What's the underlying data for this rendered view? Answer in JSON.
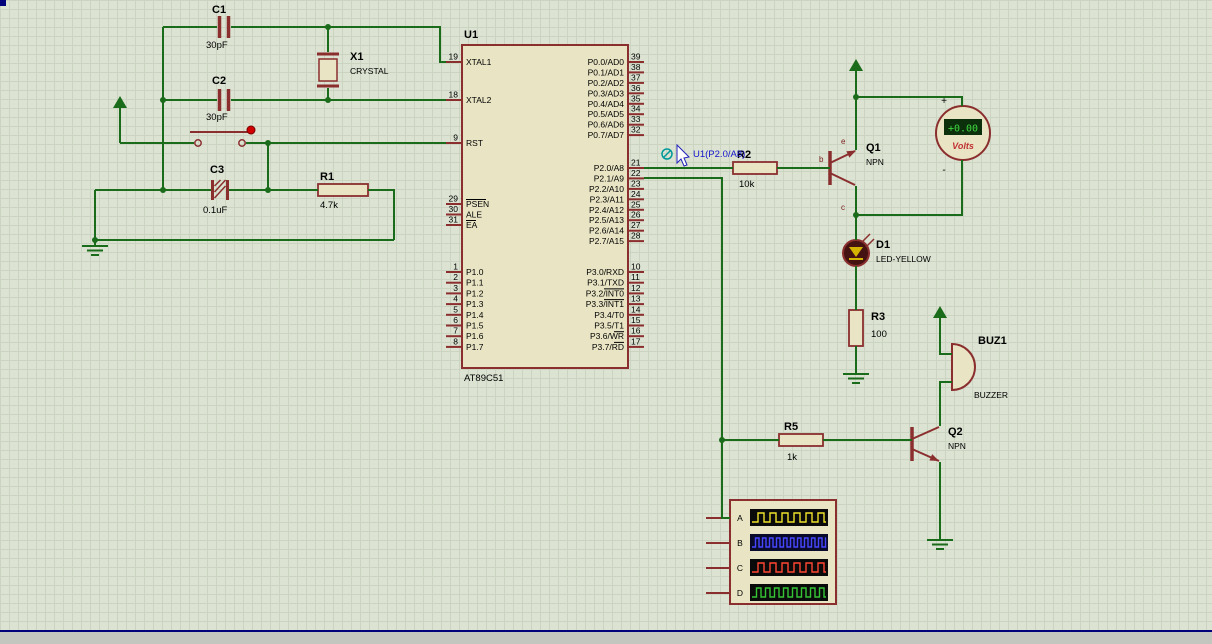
{
  "sheet": {
    "background": "#dce3d3",
    "grid": "#cad4c1",
    "wire_color": "#1a6b1a",
    "component_color": "#8b2e2e",
    "border_color": "#00007a"
  },
  "icons": {
    "probe": "voltage-probe-circle",
    "cursor": "arrow-pointer"
  },
  "annotations": {
    "probe_label": "U1(P2.0/A8)"
  },
  "components": {
    "c1": {
      "ref": "C1",
      "value": "30pF"
    },
    "c2": {
      "ref": "C2",
      "value": "30pF"
    },
    "c3": {
      "ref": "C3",
      "value": "0.1uF"
    },
    "x1": {
      "ref": "X1",
      "type": "CRYSTAL"
    },
    "r1": {
      "ref": "R1",
      "value": "4.7k"
    },
    "r2": {
      "ref": "R2",
      "value": "10k"
    },
    "r3": {
      "ref": "R3",
      "value": "100"
    },
    "r5": {
      "ref": "R5",
      "value": "1k"
    },
    "q1": {
      "ref": "Q1",
      "type": "NPN",
      "pin_e": "e",
      "pin_b": "b",
      "pin_c": "c"
    },
    "q2": {
      "ref": "Q2",
      "type": "NPN"
    },
    "d1": {
      "ref": "D1",
      "type": "LED-YELLOW"
    },
    "buz1": {
      "ref": "BUZ1",
      "type": "BUZZER"
    },
    "voltmeter": {
      "reading": "+0.00",
      "unit_label": "Volts",
      "plus": "+",
      "minus": "-"
    },
    "u1": {
      "ref": "U1",
      "part": "AT89C51",
      "left_pins": [
        {
          "num": "19",
          "name": "XTAL1"
        },
        {
          "num": "18",
          "name": "XTAL2"
        },
        {
          "num": "9",
          "name": "RST"
        },
        {
          "num": "29",
          "name": "PSEN",
          "bar": "PSEN"
        },
        {
          "num": "30",
          "name": "ALE"
        },
        {
          "num": "31",
          "name": "EA",
          "bar": "EA"
        },
        {
          "num": "1",
          "name": "P1.0"
        },
        {
          "num": "2",
          "name": "P1.1"
        },
        {
          "num": "3",
          "name": "P1.2"
        },
        {
          "num": "4",
          "name": "P1.3"
        },
        {
          "num": "5",
          "name": "P1.4"
        },
        {
          "num": "6",
          "name": "P1.5"
        },
        {
          "num": "7",
          "name": "P1.6"
        },
        {
          "num": "8",
          "name": "P1.7"
        }
      ],
      "right_pins": [
        {
          "num": "39",
          "name": "P0.0/AD0"
        },
        {
          "num": "38",
          "name": "P0.1/AD1"
        },
        {
          "num": "37",
          "name": "P0.2/AD2"
        },
        {
          "num": "36",
          "name": "P0.3/AD3"
        },
        {
          "num": "35",
          "name": "P0.4/AD4"
        },
        {
          "num": "34",
          "name": "P0.5/AD5"
        },
        {
          "num": "33",
          "name": "P0.6/AD6"
        },
        {
          "num": "32",
          "name": "P0.7/AD7"
        },
        {
          "num": "21",
          "name": "P2.0/A8"
        },
        {
          "num": "22",
          "name": "P2.1/A9"
        },
        {
          "num": "23",
          "name": "P2.2/A10"
        },
        {
          "num": "24",
          "name": "P2.3/A11"
        },
        {
          "num": "25",
          "name": "P2.4/A12"
        },
        {
          "num": "26",
          "name": "P2.5/A13"
        },
        {
          "num": "27",
          "name": "P2.6/A14"
        },
        {
          "num": "28",
          "name": "P2.7/A15"
        },
        {
          "num": "10",
          "name": "P3.0/RXD"
        },
        {
          "num": "11",
          "name": "P3.1/TXD"
        },
        {
          "num": "12",
          "name": "P3.2/INT0",
          "bar": "INT0"
        },
        {
          "num": "13",
          "name": "P3.3/INT1",
          "bar": "INT1"
        },
        {
          "num": "14",
          "name": "P3.4/T0"
        },
        {
          "num": "15",
          "name": "P3.5/T1"
        },
        {
          "num": "16",
          "name": "P3.6/WR",
          "bar": "WR"
        },
        {
          "num": "17",
          "name": "P3.7/RD",
          "bar": "RD"
        }
      ]
    },
    "oscilloscope": {
      "channels": [
        "A",
        "B",
        "C",
        "D"
      ],
      "trace_colors": [
        "#f0e22a",
        "#4646ff",
        "#ff4633",
        "#35c435"
      ]
    }
  }
}
